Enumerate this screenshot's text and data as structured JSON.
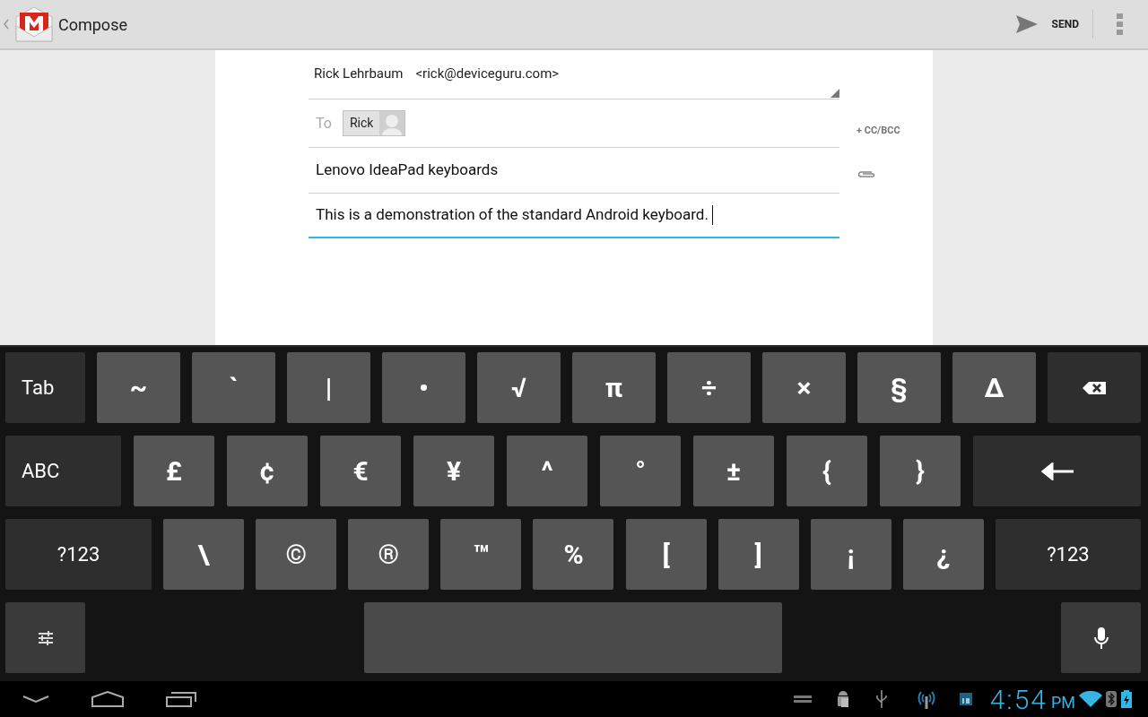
{
  "action_bar": {
    "title": "Compose",
    "send": "SEND"
  },
  "compose": {
    "from_name": "Rick Lehrbaum",
    "from_email": "<rick@deviceguru.com>",
    "to_label": "To",
    "recipients": [
      "Rick"
    ],
    "cc_bcc": "+ CC/BCC",
    "subject": "Lenovo IdeaPad keyboards",
    "body": "This is a demonstration of the standard Android keyboard."
  },
  "keyboard": {
    "rows": [
      [
        {
          "kind": "function",
          "label": "Tab"
        },
        {
          "kind": "char",
          "label": "~"
        },
        {
          "kind": "char",
          "label": "`"
        },
        {
          "kind": "char",
          "label": "|"
        },
        {
          "kind": "char",
          "label": "•"
        },
        {
          "kind": "char",
          "label": "√"
        },
        {
          "kind": "char",
          "label": "π"
        },
        {
          "kind": "char",
          "label": "÷"
        },
        {
          "kind": "char",
          "label": "×"
        },
        {
          "kind": "char",
          "label": "§"
        },
        {
          "kind": "char",
          "label": "Δ"
        },
        {
          "kind": "backspace"
        }
      ],
      [
        {
          "kind": "function",
          "label": "ABC"
        },
        {
          "kind": "char",
          "label": "£"
        },
        {
          "kind": "char",
          "label": "¢"
        },
        {
          "kind": "char",
          "label": "€"
        },
        {
          "kind": "char",
          "label": "¥"
        },
        {
          "kind": "char",
          "label": "^"
        },
        {
          "kind": "char",
          "label": "°"
        },
        {
          "kind": "char",
          "label": "±"
        },
        {
          "kind": "char",
          "label": "{"
        },
        {
          "kind": "char",
          "label": "}"
        },
        {
          "kind": "enter"
        }
      ],
      [
        {
          "kind": "function",
          "label": "?123"
        },
        {
          "kind": "char",
          "label": "\\"
        },
        {
          "kind": "char",
          "label": "©"
        },
        {
          "kind": "char",
          "label": "®"
        },
        {
          "kind": "char",
          "label": "™"
        },
        {
          "kind": "char",
          "label": "%"
        },
        {
          "kind": "char",
          "label": "["
        },
        {
          "kind": "char",
          "label": "]"
        },
        {
          "kind": "char",
          "label": "¡"
        },
        {
          "kind": "char",
          "label": "¿"
        },
        {
          "kind": "function",
          "label": "?123"
        }
      ],
      [
        {
          "kind": "settings"
        },
        {
          "kind": "space"
        },
        {
          "kind": "mic"
        }
      ]
    ]
  },
  "status_bar": {
    "time": "4:54",
    "ampm": "PM"
  }
}
